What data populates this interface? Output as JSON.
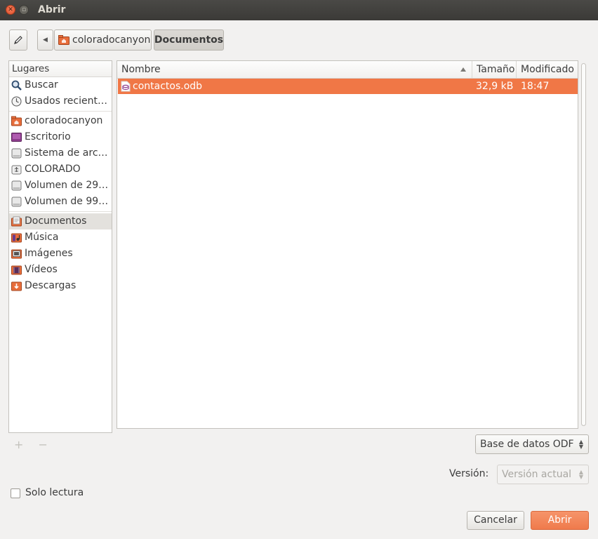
{
  "window": {
    "title": "Abrir"
  },
  "toolbar": {
    "edit_icon": "pencil-icon",
    "back_icon": "chevron-left-icon",
    "breadcrumbs": [
      {
        "label": "coloradocanyon",
        "icon": "home-folder-icon"
      },
      {
        "label": "Documentos"
      }
    ]
  },
  "sidebar": {
    "header": "Lugares",
    "items": [
      {
        "label": "Buscar",
        "icon": "search-icon"
      },
      {
        "label": "Usados recient…",
        "icon": "recent-icon"
      },
      {
        "label": "coloradocanyon",
        "icon": "home-folder-icon"
      },
      {
        "label": "Escritorio",
        "icon": "desktop-icon"
      },
      {
        "label": "Sistema de arc…",
        "icon": "drive-icon"
      },
      {
        "label": "COLORADO",
        "icon": "usb-drive-icon"
      },
      {
        "label": "Volumen de 29…",
        "icon": "drive-icon"
      },
      {
        "label": "Volumen de 99…",
        "icon": "drive-icon"
      },
      {
        "label": "Documentos",
        "icon": "documents-folder-icon",
        "active": true
      },
      {
        "label": "Música",
        "icon": "music-folder-icon"
      },
      {
        "label": "Imágenes",
        "icon": "pictures-folder-icon"
      },
      {
        "label": "Vídeos",
        "icon": "videos-folder-icon"
      },
      {
        "label": "Descargas",
        "icon": "downloads-folder-icon"
      }
    ],
    "add_label": "+",
    "remove_label": "−"
  },
  "filelist": {
    "columns": {
      "name": "Nombre",
      "size": "Tamaño",
      "modified": "Modificado"
    },
    "rows": [
      {
        "name": "contactos.odb",
        "size": "32,9 kB",
        "modified": "18:47",
        "icon": "odf-database-icon",
        "selected": true
      }
    ]
  },
  "filter": {
    "selected": "Base de datos ODF"
  },
  "version": {
    "label": "Versión:",
    "selected": "Versión actual"
  },
  "readonly": {
    "label": "Solo lectura",
    "checked": false
  },
  "buttons": {
    "cancel": "Cancelar",
    "open": "Abrir"
  },
  "colors": {
    "accent": "#f07746",
    "titlebar": "#3c3b37"
  }
}
